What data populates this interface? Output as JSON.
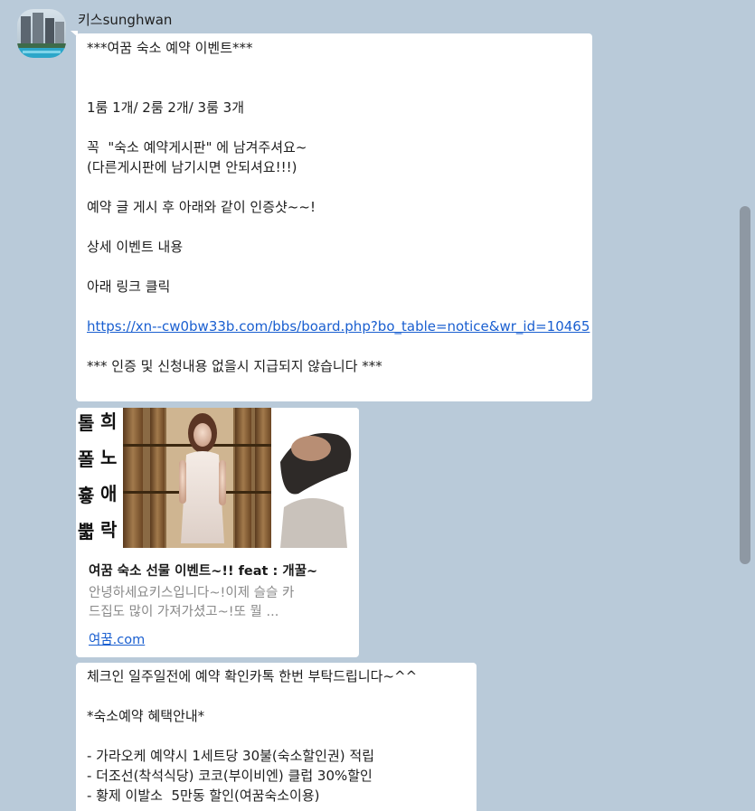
{
  "sender": {
    "name": "키스sunghwan"
  },
  "message1": {
    "title": "***여꿈 숙소 예약 이벤트***",
    "rooms": "1룸 1개/ 2룸 2개/ 3룸 3개",
    "note1": "꼭  \"숙소 예약게시판\" 에 남겨주셔요~",
    "note2": "(다른게시판에 남기시면 안되셔요!!!)",
    "note3": "예약 글 게시 후 아래와 같이 인증샷~~!",
    "detail": "상세 이벤트 내용",
    "click": "아래 링크 클릭",
    "link": "https://xn--cw0bw33b.com/bbs/board.php?bo_table=notice&wr_id=10465",
    "warning": "*** 인증 및 신청내용 없을시 지급되지 않습니다 ***"
  },
  "link_card": {
    "image_text": [
      [
        "톨",
        "희"
      ],
      [
        "폴",
        "노"
      ],
      [
        "흏",
        "애"
      ],
      [
        "뿗",
        "락"
      ]
    ],
    "title": "여꿈 숙소 선물 이벤트~!! feat : 개꿀~",
    "desc_line1": "안녕하세요키스입니다~!이제 슬슬 카",
    "desc_line2": "드집도 많이 가져가셨고~!또 뭘 ...",
    "domain": "여꿈.com"
  },
  "message3": {
    "line1": "체크인 일주일전에 예약 확인카톡 한번 부탁드립니다~^^",
    "line2": "*숙소예약 혜택안내*",
    "line3": "- 가라오케 예약시 1세트당 30불(숙소할인권) 적립",
    "line4": "- 더조선(착석식당) 코코(부이비엔) 클럽 30%할인",
    "line5": "- 황제 이발소  5만동 할인(여꿈숙소이용)"
  }
}
